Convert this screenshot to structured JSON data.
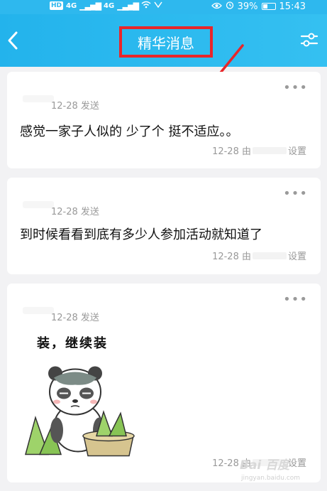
{
  "status_bar": {
    "hd": "HD",
    "net1": "4G",
    "net2": "4G",
    "battery_percent": "39%",
    "battery_level": 0.39,
    "time": "15:43"
  },
  "nav": {
    "title": "精华消息"
  },
  "messages": [
    {
      "date_sent": "12-28 发送",
      "text": "感觉一家子人似的 少了个 挺不适应。。",
      "footer_date": "12-28 由",
      "footer_action": "设置"
    },
    {
      "date_sent": "12-28 发送",
      "text": "到时候看看到底有多少人参加活动就知道了",
      "footer_date": "12-28 由",
      "footer_action": "设置"
    },
    {
      "date_sent": "12-28 发送",
      "sticker_text": "装，继续装",
      "footer_date": "12-28 由",
      "footer_action": "设置"
    }
  ],
  "more_label": "•••",
  "watermark": {
    "brand": "Bai 百度",
    "sub": "jingyan.baidu.com"
  },
  "colors": {
    "accent": "#2eb8ee",
    "highlight": "#e8262a"
  }
}
